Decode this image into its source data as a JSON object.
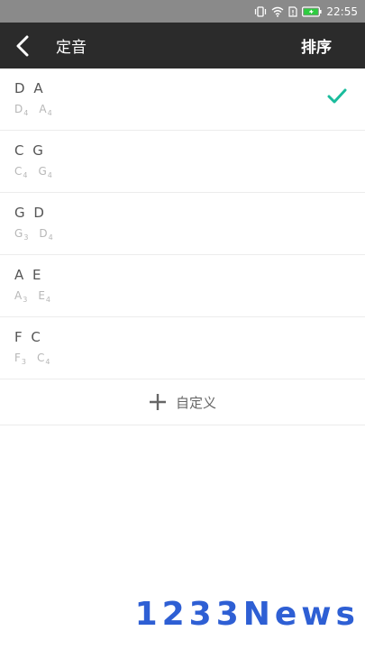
{
  "status_bar": {
    "time": "22:55",
    "icons": [
      "vibrate-icon",
      "wifi-icon",
      "sim-icon",
      "battery-icon"
    ]
  },
  "header": {
    "title": "定音",
    "sort_label": "排序"
  },
  "tunings": [
    {
      "name": "D A",
      "notes": [
        {
          "letter": "D",
          "octave": "4"
        },
        {
          "letter": "A",
          "octave": "4"
        }
      ],
      "selected": true
    },
    {
      "name": "C G",
      "notes": [
        {
          "letter": "C",
          "octave": "4"
        },
        {
          "letter": "G",
          "octave": "4"
        }
      ],
      "selected": false
    },
    {
      "name": "G D",
      "notes": [
        {
          "letter": "G",
          "octave": "3"
        },
        {
          "letter": "D",
          "octave": "4"
        }
      ],
      "selected": false
    },
    {
      "name": "A E",
      "notes": [
        {
          "letter": "A",
          "octave": "3"
        },
        {
          "letter": "E",
          "octave": "4"
        }
      ],
      "selected": false
    },
    {
      "name": "F C",
      "notes": [
        {
          "letter": "F",
          "octave": "3"
        },
        {
          "letter": "C",
          "octave": "4"
        }
      ],
      "selected": false
    }
  ],
  "custom": {
    "label": "自定义",
    "icon": "plus-icon"
  },
  "watermark": {
    "text": "1233News"
  },
  "colors": {
    "accent": "#1abc9c",
    "app_bar": "#2b2b2b",
    "status_bar": "#8a8a8a"
  }
}
